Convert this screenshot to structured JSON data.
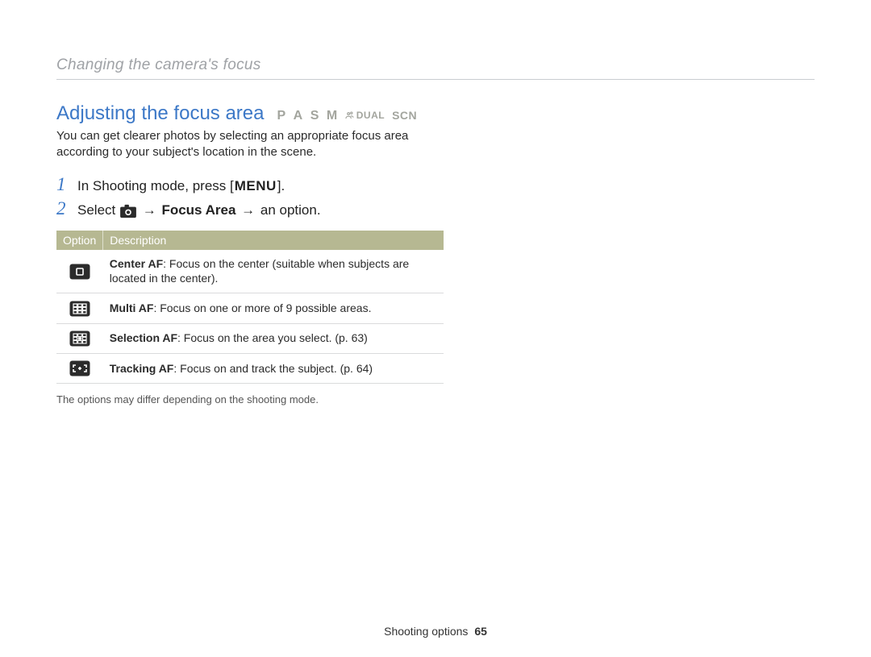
{
  "breadcrumb": "Changing the camera's focus",
  "heading": "Adjusting the focus area",
  "modes": {
    "p": "P",
    "a": "A",
    "s": "S",
    "m": "M",
    "dual": "DUAL",
    "scn": "SCN"
  },
  "intro": "You can get clearer photos by selecting an appropriate focus area according to your subject's location in the scene.",
  "steps": {
    "s1_num": "1",
    "s1_a": "In Shooting mode, press [",
    "s1_menu": "MENU",
    "s1_b": "].",
    "s2_num": "2",
    "s2_a": "Select ",
    "s2_arrow1": "→",
    "s2_focus": "Focus Area",
    "s2_arrow2": "→",
    "s2_b": " an option."
  },
  "table": {
    "h_option": "Option",
    "h_desc": "Description",
    "rows": [
      {
        "name": "Center AF",
        "desc": ": Focus on the center (suitable when subjects are located in the center)."
      },
      {
        "name": "Multi AF",
        "desc": ": Focus on one or more of 9 possible areas."
      },
      {
        "name": "Selection AF",
        "desc": ": Focus on the area you select. (p. 63)"
      },
      {
        "name": "Tracking AF",
        "desc": ": Focus on and track the subject. (p. 64)"
      }
    ]
  },
  "note": "The options may differ depending on the shooting mode.",
  "footer": {
    "section": "Shooting options",
    "page": "65"
  }
}
